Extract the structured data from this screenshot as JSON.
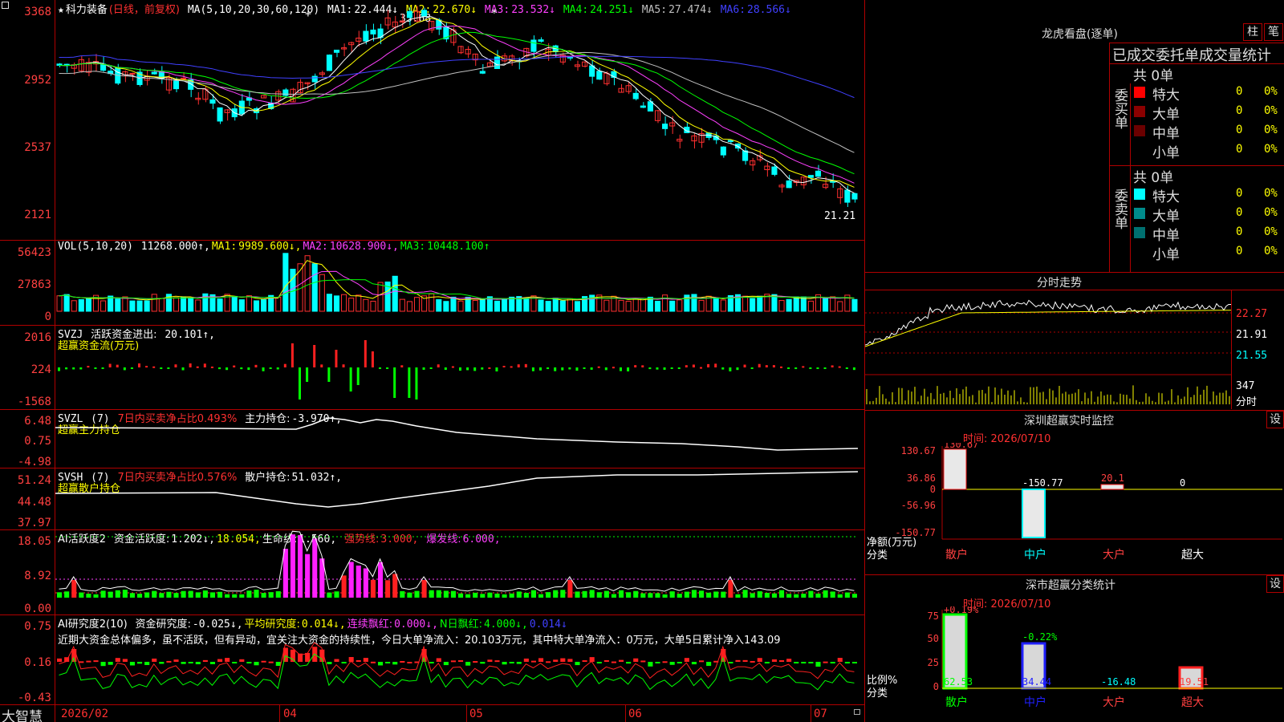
{
  "app": {
    "name": "大智慧",
    "window_menu_icon": "menu-square-icon"
  },
  "main_chart": {
    "title_prefix": "★",
    "stock": "科力装备",
    "mode": "(日线，前复权)",
    "ma_params": "MA(5,10,20,30,60,120)",
    "ma": [
      {
        "name": "MA1:",
        "value": "22.444↓",
        "color": "#ffffff"
      },
      {
        "name": "MA2:",
        "value": "22.670↓",
        "color": "#ffff00"
      },
      {
        "name": "MA3:",
        "value": "23.532↓",
        "color": "#ff40ff"
      },
      {
        "name": "MA4:",
        "value": "24.251↓",
        "color": "#00ff00"
      },
      {
        "name": "MA5:",
        "value": "27.474↓",
        "color": "#c0c0c0"
      },
      {
        "name": "MA6:",
        "value": "28.566↓",
        "color": "#4040ff"
      }
    ],
    "y_labels": [
      "3368",
      "2952",
      "2537",
      "2121"
    ],
    "high_label": "33.68",
    "low_label": "21.21",
    "markers": [
      "+",
      "*"
    ]
  },
  "vol_panel": {
    "params": "VOL(5,10,20)",
    "value": "11268.000↑,",
    "ma1_label": "MA1:",
    "ma1": "9989.600↓,",
    "ma2_label": "MA2:",
    "ma2": "10628.900↓,",
    "ma3_label": "MA3:",
    "ma3": "10448.100↑",
    "y_labels": [
      "56423",
      "27863",
      "0"
    ]
  },
  "svzj_panel": {
    "name": "SVZJ",
    "label": "活跃资金进出:",
    "value": "20.101↑,",
    "subtitle": "超赢资金流(万元)",
    "y_labels": [
      "2016",
      "224",
      "-1568"
    ]
  },
  "svzl_panel": {
    "name": "SVZL",
    "period": "(7)",
    "ratio": "7日内买卖净占比0.493%",
    "label": "主力持仓:",
    "value": "-3.970↑,",
    "subtitle": "超赢主力持仓",
    "y_labels": [
      "6.48",
      "0.75",
      "-4.98"
    ]
  },
  "svsh_panel": {
    "name": "SVSH",
    "period": "(7)",
    "ratio": "7日内买卖净占比0.576%",
    "label": "散户持仓:",
    "value": "51.032↑,",
    "subtitle": "超赢散户持仓",
    "y_labels": [
      "51.24",
      "44.48",
      "37.97"
    ]
  },
  "ai_active_panel": {
    "name": "AI活跃度2",
    "label1": "资金活跃度:",
    "value1": "1.202↓,",
    "value1b": "18.054,",
    "label2": "生命线:",
    "value2": "1.560,",
    "label3": "强势线:",
    "value3": "3.000,",
    "label4": "爆发线:",
    "value4": "6.000,",
    "y_labels": [
      "18.05",
      "8.92",
      "0.00"
    ]
  },
  "ai_research_panel": {
    "name": "AI研究度2(10)",
    "label1": "资金研究度:",
    "value1": "-0.025↓,",
    "label2": "平均研究度:",
    "value2": "0.014↓,",
    "label3": "连续飘红:",
    "value3": "0.000↓,",
    "label4": "N日飘红:",
    "value4": "4.000↓,",
    "value5": "0.014↓",
    "comment": "近期大资金总体偏多，虽不活跃，但有异动，宜关注大资金的持续性，今日大单净流入：20.103万元，其中特大单净流入：0万元，大单5日累计净入143.09",
    "y_labels": [
      "0.75",
      "0.16",
      "-0.43"
    ]
  },
  "x_axis": {
    "labels": [
      "2026/02",
      "04",
      "05",
      "06",
      "07"
    ]
  },
  "right_panel": {
    "tabs": [
      "柱",
      "笔"
    ],
    "dragon_title": "龙虎看盘(逐单)",
    "stats_title": "已成交委托单成交量统计",
    "buy_group": {
      "side_label": "委买单",
      "total": "共 0单",
      "rows": [
        {
          "label": "特大",
          "count": "0",
          "pct": "0%",
          "color": "#ff0000"
        },
        {
          "label": "大单",
          "count": "0",
          "pct": "0%",
          "color": "#8b0000"
        },
        {
          "label": "中单",
          "count": "0",
          "pct": "0%",
          "color": "#6b0000"
        },
        {
          "label": "小单",
          "count": "0",
          "pct": "0%",
          "color": ""
        }
      ]
    },
    "sell_group": {
      "side_label": "委卖单",
      "total": "共 0单",
      "rows": [
        {
          "label": "特大",
          "count": "0",
          "pct": "0%",
          "color": "#00ffff"
        },
        {
          "label": "大单",
          "count": "0",
          "pct": "0%",
          "color": "#008b8b"
        },
        {
          "label": "中单",
          "count": "0",
          "pct": "0%",
          "color": "#007070"
        },
        {
          "label": "小单",
          "count": "0",
          "pct": "0%",
          "color": ""
        }
      ]
    },
    "intraday": {
      "title": "分时走势",
      "y_labels": [
        "22.27",
        "21.91",
        "21.55"
      ],
      "vol_label": "347",
      "vol_unit": "分时"
    },
    "monitor": {
      "title": "深圳超赢实时监控",
      "settings": "设",
      "time": "时间: 2026/07/10",
      "y_labels": [
        "130.67",
        "36.86",
        "0",
        "-56.96",
        "-150.77"
      ],
      "unit_label": "净额(万元)",
      "cat_label": "分类",
      "categories": [
        "散户",
        "中户",
        "大户",
        "超大"
      ],
      "values": [
        "130.67",
        "-150.77",
        "20.1",
        "0"
      ]
    },
    "classify": {
      "title": "深市超赢分类统计",
      "settings": "设",
      "time": "时间: 2026/07/10",
      "y_labels": [
        "75",
        "50",
        "25",
        "0"
      ],
      "top_values": [
        "+0.19%",
        "-0.22%"
      ],
      "ratio_label": "比例%",
      "cat_label": "分类",
      "bottom_values": [
        "62.53",
        "34.44",
        "-16.48",
        "19.51"
      ],
      "categories": [
        "散户",
        "中户",
        "大户",
        "超大"
      ]
    }
  }
}
